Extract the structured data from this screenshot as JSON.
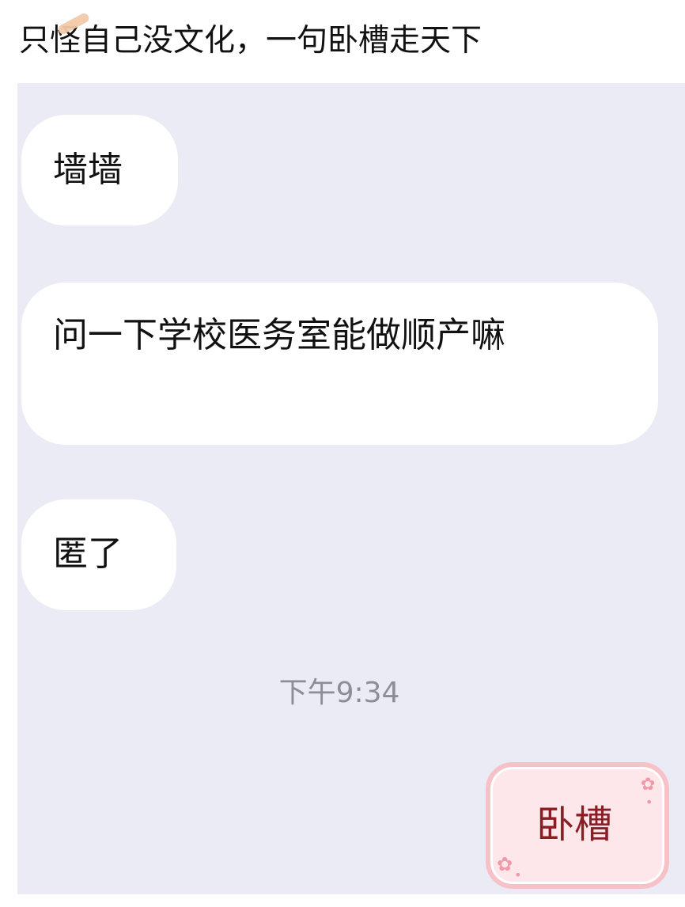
{
  "post": {
    "caption": "只怪自己没文化，一句卧槽走天下"
  },
  "chat": {
    "incoming_messages": [
      {
        "text": "墙墙"
      },
      {
        "text": "问一下学校医务室能做顺产嘛"
      },
      {
        "text": "匿了"
      }
    ],
    "timestamp": "下午9:34",
    "outgoing_messages": [
      {
        "text": "卧槽"
      }
    ]
  },
  "style": {
    "background": "#ebebf6",
    "incoming_bubble": "#ffffff",
    "outgoing_bubble": "#fde7ea",
    "outgoing_border": "#f7c1c8",
    "outgoing_text": "#8b1e24",
    "timestamp_text": "#8d8d96"
  },
  "icons": {
    "caption_decoration": "highlighter-stroke-icon",
    "bubble_decoration": "flower-icon"
  }
}
